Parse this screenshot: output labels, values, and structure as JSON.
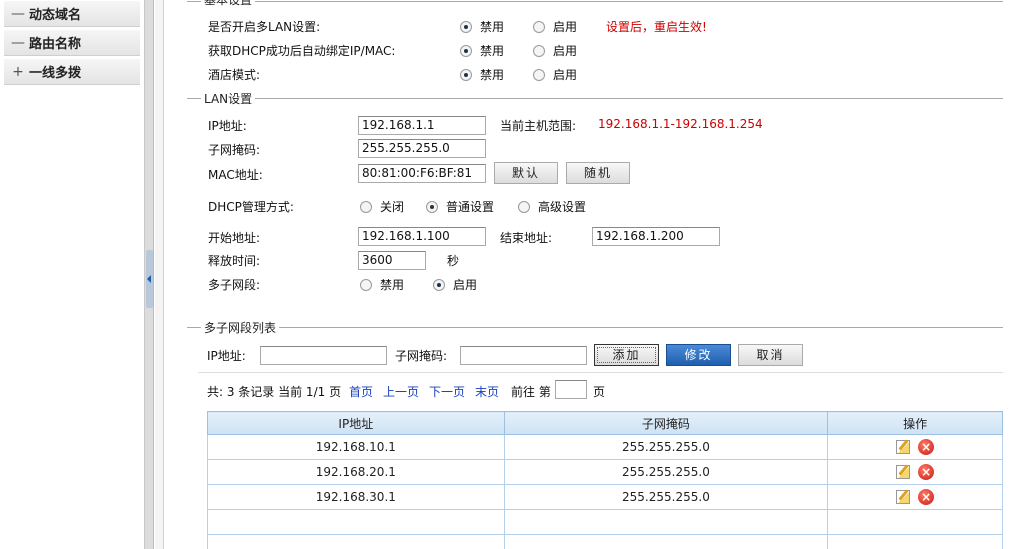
{
  "sidebar": {
    "items": [
      {
        "prefix": "—",
        "label": "动态域名"
      },
      {
        "prefix": "—",
        "label": "路由名称"
      },
      {
        "prefix": "+",
        "label": "一线多拨"
      }
    ]
  },
  "basic": {
    "legend": "基本设置",
    "rows": [
      {
        "label": "是否开启多LAN设置:",
        "opt1": "禁用",
        "opt2": "启用",
        "selected": "禁用"
      },
      {
        "label": "获取DHCP成功后自动绑定IP/MAC:",
        "opt1": "禁用",
        "opt2": "启用",
        "selected": "禁用"
      },
      {
        "label": "酒店模式:",
        "opt1": "禁用",
        "opt2": "启用",
        "selected": "禁用"
      }
    ],
    "notice": "设置后，重启生效!"
  },
  "lan": {
    "legend": "LAN设置",
    "ip_label": "IP地址:",
    "ip_value": "192.168.1.1",
    "range_label": "当前主机范围:",
    "range_value": "192.168.1.1-192.168.1.254",
    "mask_label": "子网掩码:",
    "mask_value": "255.255.255.0",
    "mac_label": "MAC地址:",
    "mac_value": "80:81:00:F6:BF:81",
    "default_btn": "默认",
    "random_btn": "随机",
    "dhcp_label": "DHCP管理方式:",
    "dhcp_opts": [
      "关闭",
      "普通设置",
      "高级设置"
    ],
    "dhcp_selected": "普通设置",
    "start_label": "开始地址:",
    "start_value": "192.168.1.100",
    "end_label": "结束地址:",
    "end_value": "192.168.1.200",
    "lease_label": "释放时间:",
    "lease_value": "3600",
    "lease_unit": "秒",
    "multi_label": "多子网段:",
    "multi_opts": [
      "禁用",
      "启用"
    ],
    "multi_selected": "启用"
  },
  "subnet": {
    "legend": "多子网段列表",
    "ip_label": "IP地址:",
    "ip_value": "",
    "mask_label": "子网掩码:",
    "mask_value": "",
    "add_btn": "添加",
    "modify_btn": "修改",
    "cancel_btn": "取消",
    "pager": {
      "summary": "共: 3 条记录 当前 1/1 页",
      "first": "首页",
      "prev": "上一页",
      "next": "下一页",
      "last": "末页",
      "goto_pre": "前往 第",
      "goto_post": "页",
      "page_value": ""
    },
    "table": {
      "headers": [
        "IP地址",
        "子网掩码",
        "操作"
      ],
      "rows": [
        {
          "ip": "192.168.10.1",
          "mask": "255.255.255.0"
        },
        {
          "ip": "192.168.20.1",
          "mask": "255.255.255.0"
        },
        {
          "ip": "192.168.30.1",
          "mask": "255.255.255.0"
        }
      ]
    }
  },
  "colors": {
    "notice": "#cc0000",
    "link": "#1a3fbf",
    "primary_button": "#1f5fb0",
    "table_header": "#cde2f4"
  },
  "icons": {
    "edit": "edit-icon",
    "delete": "delete-icon",
    "collapse": "collapse-arrow-icon"
  }
}
